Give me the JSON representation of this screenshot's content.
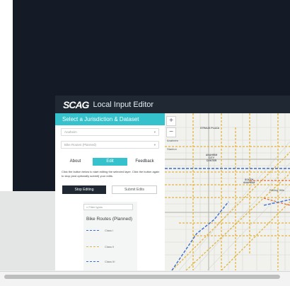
{
  "app": {
    "logo": "SCAG",
    "title": "Local Input Editor"
  },
  "panel": {
    "heading": "Select a Jurisdiction & Dataset",
    "jurisdiction_select": "Anaheim",
    "dataset_select": "Bike Routes (Planned)",
    "tabs": [
      {
        "label": "About",
        "active": false
      },
      {
        "label": "Edit",
        "active": true
      },
      {
        "label": "Feedback",
        "active": false
      }
    ],
    "help_text": "Click the button below to start editing the selected layer. Click the button again to stop (and optionally submit) your edits.",
    "stop_editing_label": "Stop Editing",
    "submit_edits_label": "Submit Edits"
  },
  "legend": {
    "filter_placeholder": "Filter types",
    "title": "Bike Routes (Planned)",
    "items": [
      {
        "label": "Class I",
        "color": "#3d6fd1"
      },
      {
        "label": "Class II",
        "color": "#e0b64a"
      },
      {
        "label": "Class III",
        "color": "#3d6fd1"
      }
    ]
  },
  "map": {
    "zoom_in": "+",
    "zoom_out": "−",
    "labels": [
      "STRAUS PLAZA",
      "ANAHEIM CITY CENTER",
      "SOUTH ANAHEIM",
      "Rolling Hills",
      "Stanton",
      "Anaheim"
    ]
  },
  "colors": {
    "accent": "#35c2cc",
    "header": "#1f2833",
    "dark_bg": "#141a26"
  }
}
